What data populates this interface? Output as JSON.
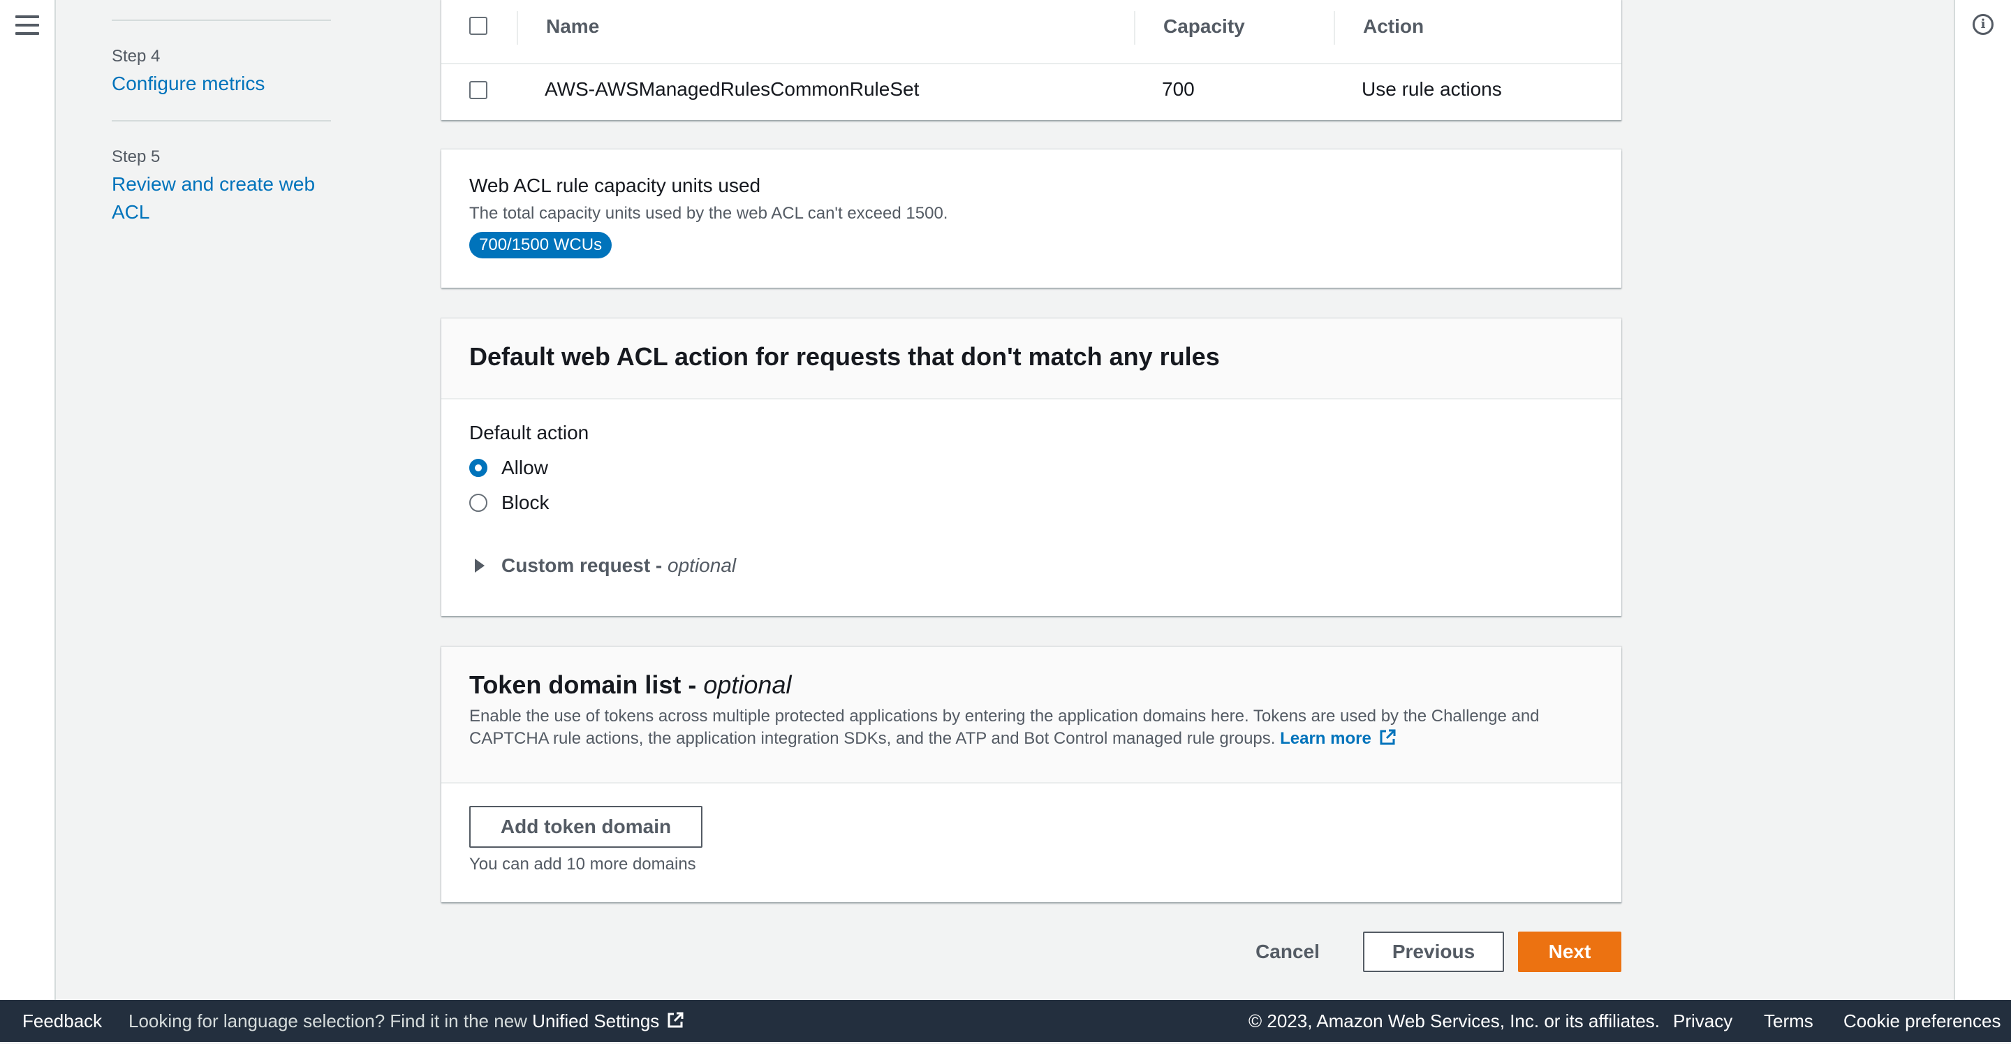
{
  "wizard": {
    "steps": [
      {
        "number": "Step 4",
        "label": "Configure metrics"
      },
      {
        "number": "Step 5",
        "label": "Review and create web ACL"
      }
    ]
  },
  "rules_table": {
    "columns": [
      "Name",
      "Capacity",
      "Action"
    ],
    "rows": [
      {
        "name": "AWS-AWSManagedRulesCommonRuleSet",
        "capacity": "700",
        "action": "Use rule actions"
      }
    ]
  },
  "capacity": {
    "title": "Web ACL rule capacity units used",
    "description": "The total capacity units used by the web ACL can't exceed 1500.",
    "badge": "700/1500 WCUs",
    "used": 700,
    "limit": 1500
  },
  "default_action": {
    "heading": "Default web ACL action for requests that don't match any rules",
    "label": "Default action",
    "options": [
      "Allow",
      "Block"
    ],
    "selected": "Allow",
    "custom_request_label": "Custom request - ",
    "custom_request_optional": "optional"
  },
  "token_domain": {
    "heading": "Token domain list - ",
    "heading_optional": "optional",
    "description_line1": "Enable the use of tokens across multiple protected applications by entering the application domains here. Tokens are used by the Challenge and",
    "description_line2": "CAPTCHA rule actions, the application integration SDKs, and the ATP and Bot Control managed rule groups.",
    "learn_more": "Learn more",
    "add_button": "Add token domain",
    "hint": "You can add 10 more domains"
  },
  "actions": {
    "cancel": "Cancel",
    "previous": "Previous",
    "next": "Next"
  },
  "footer": {
    "feedback": "Feedback",
    "language_text": "Looking for language selection? Find it in the new",
    "unified_settings": "Unified Settings",
    "copyright": "© 2023, Amazon Web Services, Inc. or its affiliates.",
    "privacy": "Privacy",
    "terms": "Terms",
    "cookie_preferences": "Cookie preferences"
  },
  "colors": {
    "link": "#0073bb",
    "primary_button": "#ec7211",
    "footer_bg": "#232f3e",
    "page_bg": "#f2f3f3"
  },
  "icons": [
    "menu-icon",
    "info-icon",
    "external-link-icon",
    "caret-right-icon"
  ]
}
